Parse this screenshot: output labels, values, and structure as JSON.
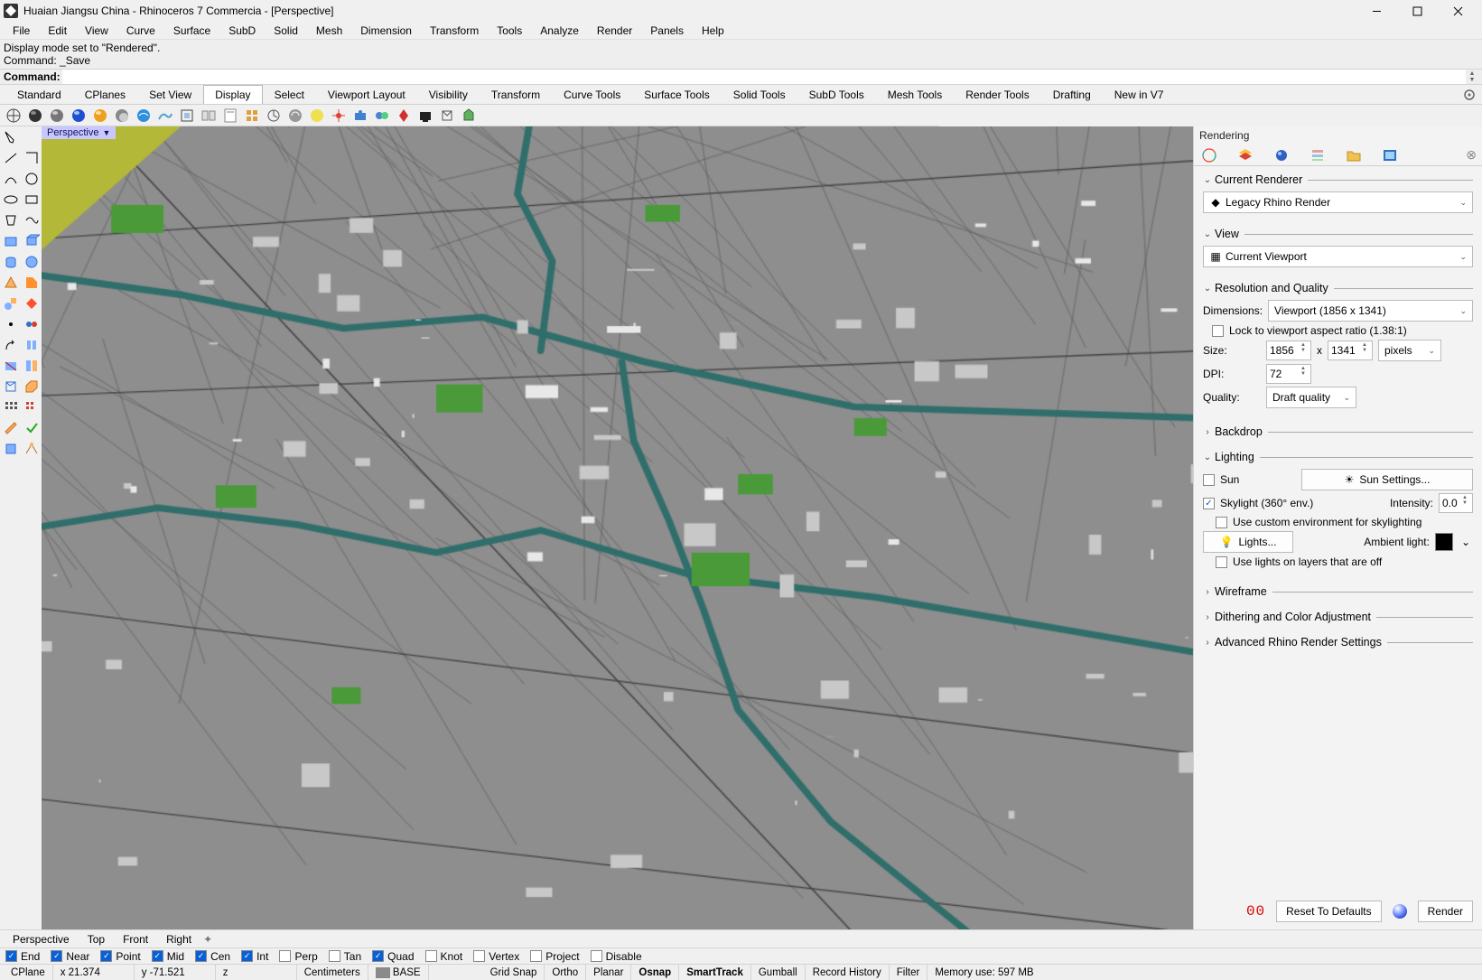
{
  "title": "Huaian Jiangsu China - Rhinoceros 7 Commercia - [Perspective]",
  "menus": [
    "File",
    "Edit",
    "View",
    "Curve",
    "Surface",
    "SubD",
    "Solid",
    "Mesh",
    "Dimension",
    "Transform",
    "Tools",
    "Analyze",
    "Render",
    "Panels",
    "Help"
  ],
  "cmd_history": [
    "Display mode set to \"Rendered\".",
    "Command: _Save"
  ],
  "cmd_prompt": "Command:",
  "tabs": [
    "Standard",
    "CPlanes",
    "Set View",
    "Display",
    "Select",
    "Viewport Layout",
    "Visibility",
    "Transform",
    "Curve Tools",
    "Surface Tools",
    "Solid Tools",
    "SubD Tools",
    "Mesh Tools",
    "Render Tools",
    "Drafting",
    "New in V7"
  ],
  "active_tab": 3,
  "viewport_label": "Perspective",
  "vptabs": [
    "Perspective",
    "Top",
    "Front",
    "Right"
  ],
  "osnaps": [
    {
      "label": "End",
      "on": true
    },
    {
      "label": "Near",
      "on": true
    },
    {
      "label": "Point",
      "on": true
    },
    {
      "label": "Mid",
      "on": true
    },
    {
      "label": "Cen",
      "on": true
    },
    {
      "label": "Int",
      "on": true
    },
    {
      "label": "Perp",
      "on": false
    },
    {
      "label": "Tan",
      "on": false
    },
    {
      "label": "Quad",
      "on": true
    },
    {
      "label": "Knot",
      "on": false
    },
    {
      "label": "Vertex",
      "on": false
    },
    {
      "label": "Project",
      "on": false
    },
    {
      "label": "Disable",
      "on": false
    }
  ],
  "status": {
    "cplane": "CPlane",
    "x": "x 21.374",
    "y": "y -71.521",
    "z": "z",
    "units": "Centimeters",
    "layer": "BASE",
    "layer_color": "#8a8a8a",
    "toggles": [
      "Grid Snap",
      "Ortho",
      "Planar",
      "Osnap",
      "SmartTrack",
      "Gumball",
      "Record History",
      "Filter"
    ],
    "bold_toggles": [
      "Osnap",
      "SmartTrack"
    ],
    "memory": "Memory use: 597 MB"
  },
  "panel": {
    "title": "Rendering",
    "sections": {
      "renderer": {
        "title": "Current Renderer",
        "value": "Legacy Rhino Render"
      },
      "view": {
        "title": "View",
        "value": "Current Viewport"
      },
      "res": {
        "title": "Resolution and Quality",
        "dim_label": "Dimensions:",
        "dim_value": "Viewport (1856 x 1341)",
        "lock_label": "Lock to viewport aspect ratio (1.38:1)",
        "lock_on": false,
        "size_label": "Size:",
        "w": "1856",
        "h": "1341",
        "x": "x",
        "unit": "pixels",
        "dpi_label": "DPI:",
        "dpi": "72",
        "quality_label": "Quality:",
        "quality": "Draft quality"
      },
      "backdrop": {
        "title": "Backdrop"
      },
      "lighting": {
        "title": "Lighting",
        "sun_label": "Sun",
        "sun_on": false,
        "sun_btn": "Sun Settings...",
        "sky_label": "Skylight (360° env.)",
        "sky_on": true,
        "intensity_label": "Intensity:",
        "intensity": "0.0",
        "custom_label": "Use custom environment for skylighting",
        "custom_on": false,
        "lights_btn": "Lights...",
        "ambient_label": "Ambient light:",
        "ambient_color": "#000000",
        "layers_label": "Use lights on layers that are off",
        "layers_on": false
      },
      "wire": {
        "title": "Wireframe"
      },
      "dither": {
        "title": "Dithering and Color Adjustment"
      },
      "adv": {
        "title": "Advanced Rhino Render Settings"
      }
    },
    "footer": {
      "timer": "00",
      "reset": "Reset To Defaults",
      "render": "Render"
    }
  }
}
